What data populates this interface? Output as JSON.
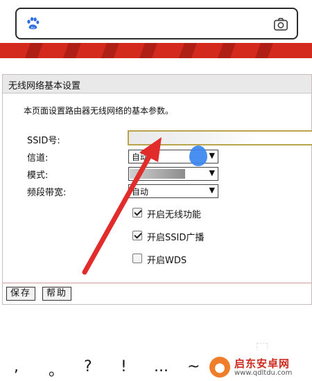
{
  "browser": {
    "search_placeholder": "",
    "icons": {
      "left": "paw-icon",
      "right": "camera-icon"
    }
  },
  "router": {
    "panel_title": "无线网络基本设置",
    "description": "本页面设置路由器无线网络的基本参数。",
    "fields": {
      "ssid_label": "SSID号:",
      "ssid_value": "",
      "channel_label": "信道:",
      "channel_value": "自动",
      "mode_label": "模式:",
      "mode_value": "",
      "bandwidth_label": "频段带宽:",
      "bandwidth_value": "自动"
    },
    "checkboxes": [
      {
        "label": "开启无线功能",
        "checked": true
      },
      {
        "label": "开启SSID广播",
        "checked": true
      },
      {
        "label": "开启WDS",
        "checked": false
      }
    ],
    "buttons": {
      "save": "保存",
      "help": "帮助"
    },
    "colors": {
      "banner_red": "#d42a1e",
      "arrow_red": "#e22b2b",
      "marker_blue": "#3a86f0"
    }
  },
  "keyboard": {
    "punctuation": [
      ",",
      "。",
      "?",
      "!",
      "...",
      "~"
    ]
  },
  "watermark": {
    "title": "启东安卓网",
    "url": "www.qdltdu.com"
  }
}
